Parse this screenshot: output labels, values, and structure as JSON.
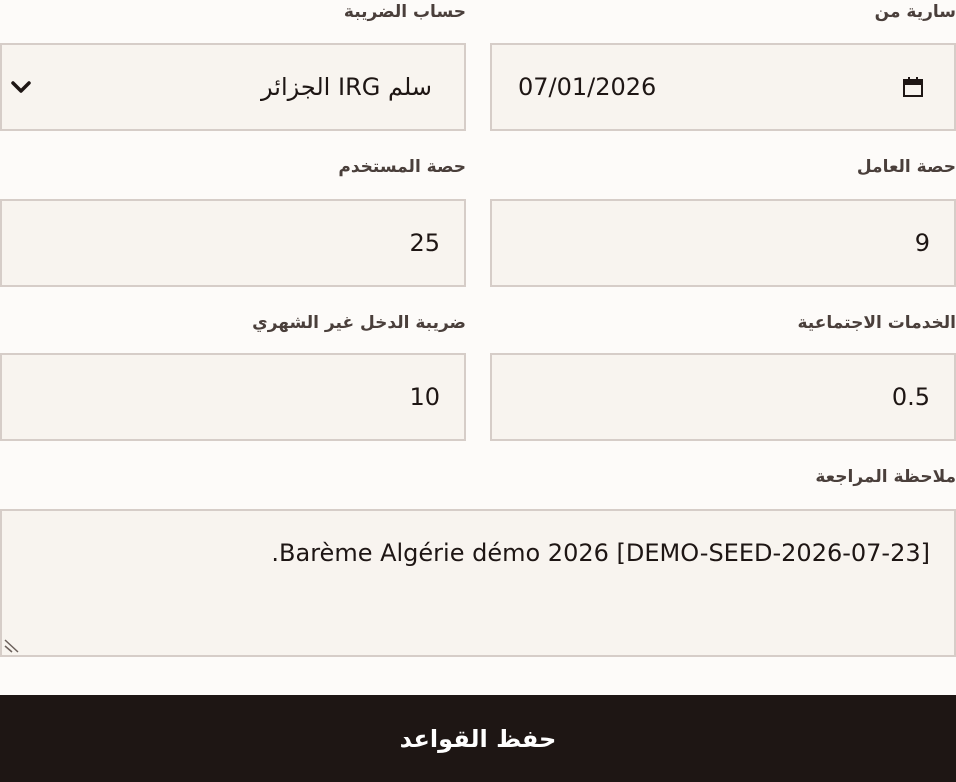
{
  "form": {
    "effective_from": {
      "label": "سارية من",
      "value": "07/01/2026"
    },
    "tax_calculation": {
      "label": "حساب الضريبة",
      "value": "سلم IRG الجزائر"
    },
    "employee_share": {
      "label": "حصة العامل",
      "value": "9"
    },
    "employer_share": {
      "label": "حصة المستخدم",
      "value": "25"
    },
    "social_services": {
      "label": "الخدمات الاجتماعية",
      "value": "0.5"
    },
    "non_monthly_income_tax": {
      "label": "ضريبة الدخل غير الشهري",
      "value": "10"
    },
    "review_note": {
      "label": "ملاحظة المراجعة",
      "value": "Barème Algérie démo 2026 [DEMO-SEED-2026-07-23]."
    },
    "save_label": "حفظ القواعد"
  },
  "icons": {
    "select": "chevron-down-icon",
    "date": "calendar-icon",
    "textarea": "resize-grip-icon"
  }
}
